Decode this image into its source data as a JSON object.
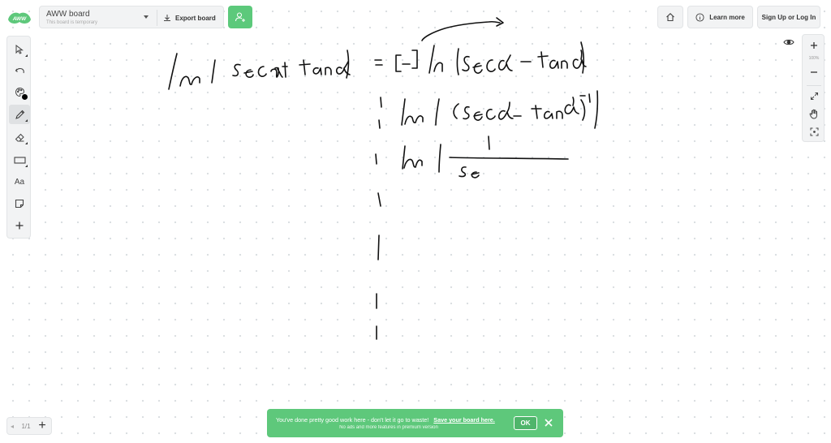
{
  "app": {
    "logo_text": "AWW"
  },
  "board": {
    "title": "AWW board",
    "subtitle": "This board is temporary",
    "export_label": "Export board"
  },
  "header": {
    "learn_more_label": "Learn more",
    "signup_label": "Sign Up or Log In"
  },
  "toolbar": {
    "text_tool_label": "Aa",
    "tools": [
      "select-icon",
      "undo-icon",
      "palette-icon",
      "pen-icon",
      "eraser-icon",
      "rectangle-icon",
      "text-tool",
      "sticky-note-icon",
      "add-icon"
    ],
    "active_tool": "pen-icon",
    "current_color": "#000000"
  },
  "zoom": {
    "zoom_in_icon": "plus-icon",
    "zoom_out_icon": "minus-icon",
    "level_label": "100%"
  },
  "pager": {
    "label": "1/1"
  },
  "banner": {
    "message": "You've done pretty good work here - don't let it go to waste!",
    "link_text": "Save your board here.",
    "sub_text": "No ads and more features in premium version",
    "ok_label": "OK"
  },
  "colors": {
    "accent_green": "#5ec87b",
    "toolbar_bg": "#f2f3f4",
    "ink": "#111111"
  }
}
